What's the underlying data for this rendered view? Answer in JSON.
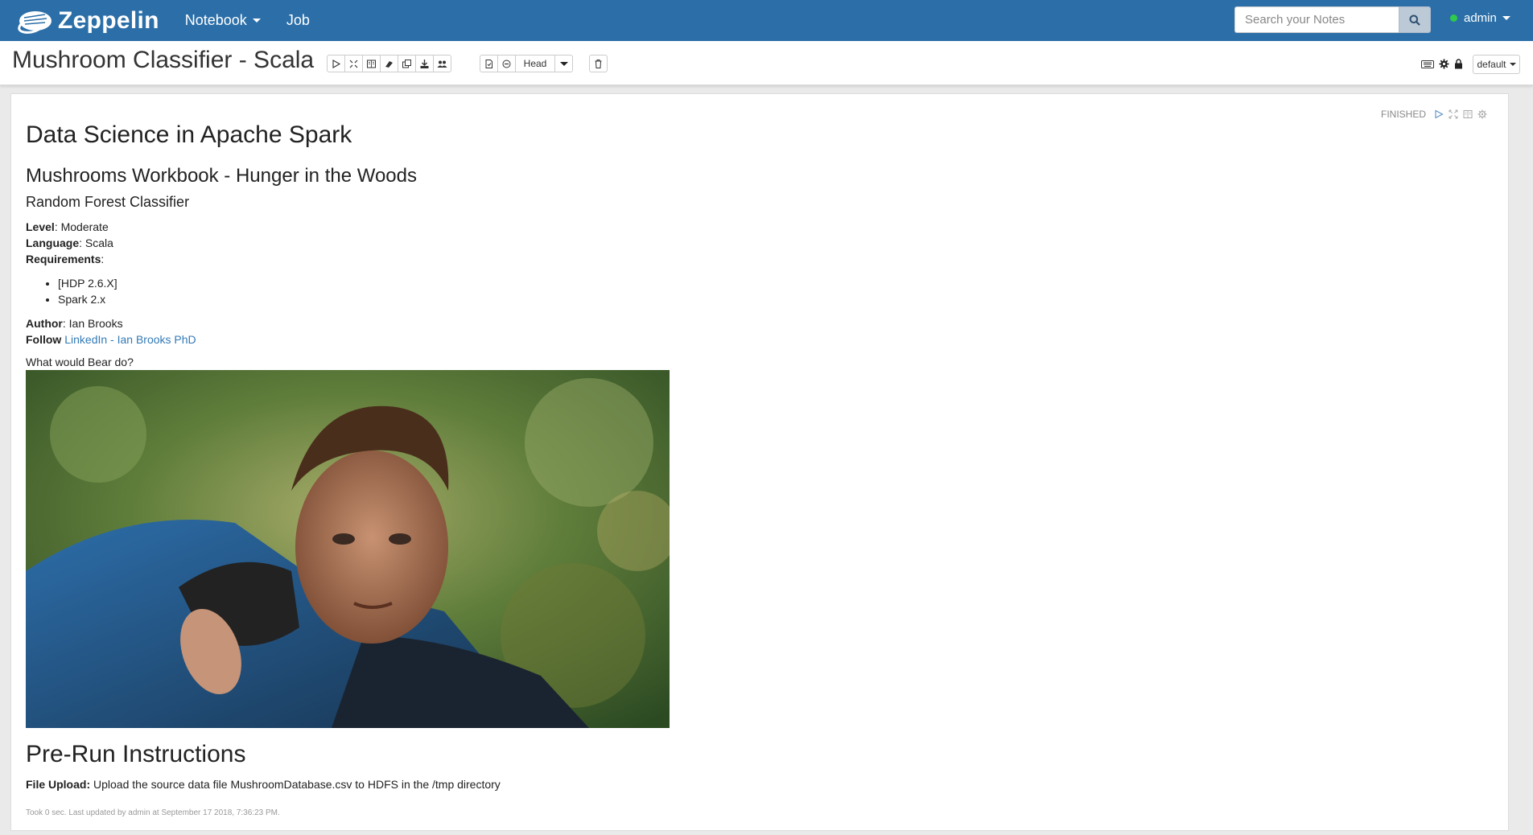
{
  "navbar": {
    "brand": "Zeppelin",
    "menu": [
      {
        "label": "Notebook",
        "has_caret": true
      },
      {
        "label": "Job",
        "has_caret": false
      }
    ],
    "search_placeholder": "Search your Notes",
    "user": "admin",
    "status_color": "#2fc94b",
    "bar_color": "#2c6fa8"
  },
  "note": {
    "title": "Mushroom Classifier - Scala",
    "toolbar_group1": [
      "run-all-icon",
      "collapse-code-icon",
      "show-output-icon",
      "clear-output-icon",
      "clone-icon",
      "export-icon",
      "collaborators-icon"
    ],
    "toolbar_group2": [
      "commit-icon",
      "revision-icon"
    ],
    "revision_label": "Head",
    "trash_icon": "trash-icon",
    "right_tools": [
      "keyboard-icon",
      "settings-icon",
      "lock-icon"
    ],
    "interpreter_label": "default"
  },
  "paragraph": {
    "status": "FINISHED",
    "controls": [
      "run-icon",
      "expand-icon",
      "book-icon",
      "gear-icon"
    ],
    "heading1": "Data Science in Apache Spark",
    "heading2": "Mushrooms Workbook - Hunger in the Woods",
    "heading3": "Random Forest Classifier",
    "level_label": "Level",
    "level_value": ": Moderate",
    "language_label": "Language",
    "language_value": ": Scala",
    "requirements_label": "Requirements",
    "requirements_suffix": ":",
    "requirements": [
      "[HDP 2.6.X]",
      "Spark 2.x"
    ],
    "author_label": "Author",
    "author_value": ": Ian Brooks",
    "follow_label": "Follow",
    "follow_link": "LinkedIn - Ian Brooks PhD",
    "bear_caption": "What would Bear do?",
    "prerun_heading": "Pre-Run Instructions",
    "upload_label": "File Upload:",
    "upload_text": " Upload the source data file MushroomDatabase.csv to HDFS in the /tmp directory",
    "footnote": "Took 0 sec. Last updated by admin at September 17 2018, 7:36:23 PM."
  }
}
